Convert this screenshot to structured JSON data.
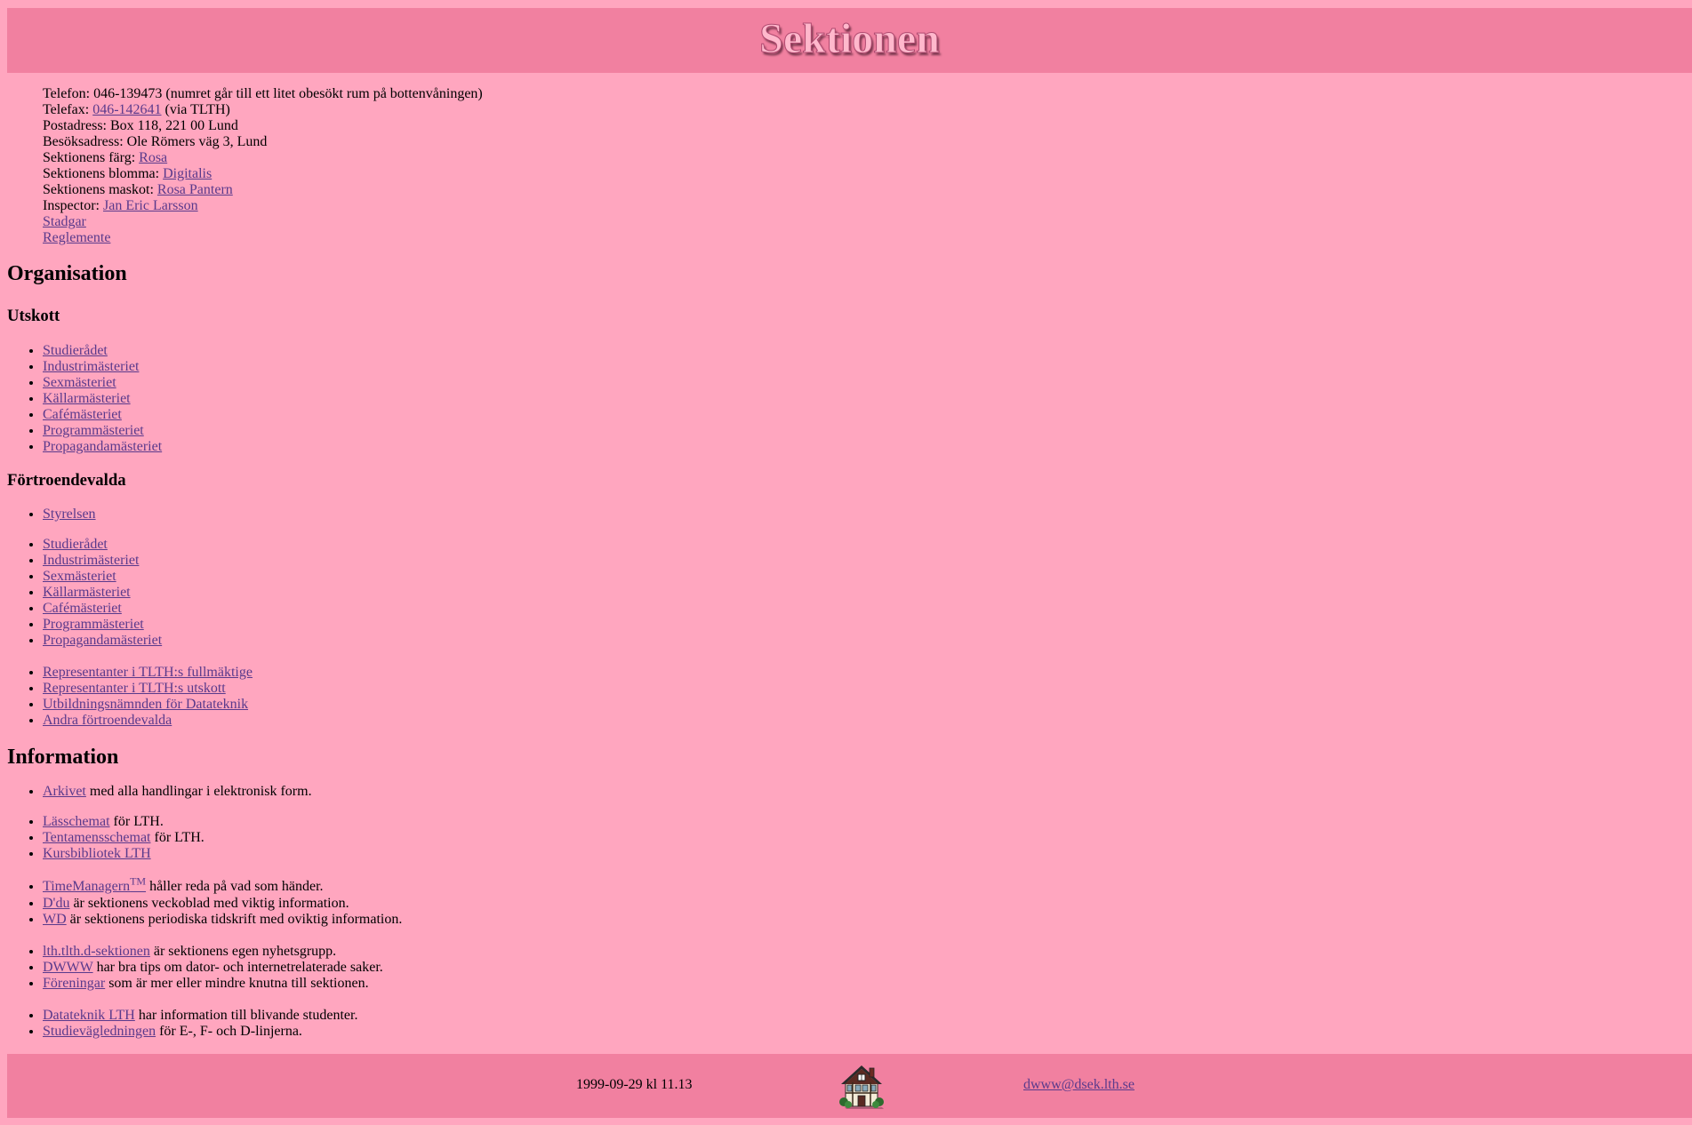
{
  "header": {
    "title": "Sektionen"
  },
  "contact": {
    "telefon": "Telefon: 046-139473 (numret går till ett litet obesökt rum på bottenvåningen)",
    "telefax_label": "Telefax: ",
    "telefax_link": "046-142641",
    "telefax_suffix": " (via TLTH)",
    "postadress": "Postadress: Box 118, 221 00 Lund",
    "besoksadress": "Besöksadress: Ole Römers väg 3, Lund",
    "farg_label": "Sektionens färg: ",
    "farg_link": "Rosa",
    "blomma_label": "Sektionens blomma: ",
    "blomma_link": "Digitalis",
    "maskot_label": "Sektionens maskot: ",
    "maskot_link": "Rosa Pantern",
    "inspector_label": "Inspector: ",
    "inspector_link": "Jan Eric Larsson",
    "stadgar": "Stadgar",
    "reglemente": "Reglemente"
  },
  "organisation": {
    "heading": "Organisation",
    "utskott_heading": "Utskott",
    "utskott": [
      "Studierådet",
      "Industrimästeriet",
      "Sexmästeriet",
      "Källarmästeriet",
      "Cafémästeriet",
      "Programmästeriet",
      "Propagandamästeriet"
    ],
    "fortroendevalda_heading": "Förtroendevalda",
    "styrelsen": [
      "Styrelsen"
    ],
    "mastare": [
      "Studierådet",
      "Industrimästeriet",
      "Sexmästeriet",
      "Källarmästeriet",
      "Cafémästeriet",
      "Programmästeriet",
      "Propagandamästeriet"
    ],
    "ovriga": [
      "Representanter i TLTH:s fullmäktige",
      "Representanter i TLTH:s utskott",
      "Utbildningsnämnden för Datateknik",
      "Andra förtroendevalda"
    ]
  },
  "information": {
    "heading": "Information",
    "arkivet_link": "Arkivet",
    "arkivet_text": " med alla handlingar i elektronisk form.",
    "lasschemat_link": "Lässchemat",
    "lasschemat_text": " för LTH.",
    "tentamensschemat_link": "Tentamensschemat",
    "tentamensschemat_text": " för LTH.",
    "kursbibliotek_link": "Kursbibliotek LTH",
    "timemanager_link": "TimeManagern",
    "timemanager_sup": "TM",
    "timemanager_text": " håller reda på vad som händer.",
    "ddu_link": "D'du",
    "ddu_text": " är sektionens veckoblad med viktig information.",
    "wd_link": "WD",
    "wd_text": " är sektionens periodiska tidskrift med oviktig information.",
    "news_link": "lth.tlth.d-sektionen",
    "news_text": " är sektionens egen nyhetsgrupp.",
    "dwww_link": "DWWW",
    "dwww_text": " har bra tips om dator- och internetrelaterade saker.",
    "foreningar_link": "Föreningar",
    "foreningar_text": " som är mer eller mindre knutna till sektionen.",
    "datateknik_link": "Datateknik LTH",
    "datateknik_text": " har information till blivande studenter.",
    "studievagledningen_link": "Studievägledningen",
    "studievagledningen_text": " för E-, F- och D-linjerna."
  },
  "footer": {
    "date": "1999-09-29 kl 11.13",
    "house_icon": "house-icon",
    "email": "dwww@dsek.lth.se"
  }
}
